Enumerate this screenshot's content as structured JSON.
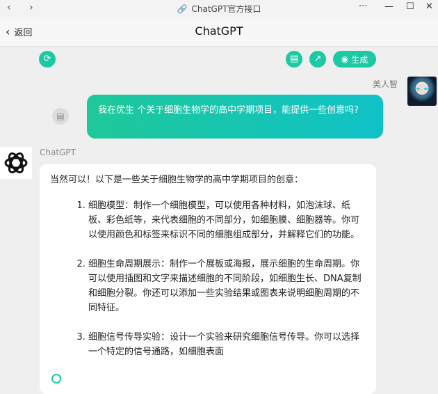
{
  "window": {
    "title": "ChatGPT官方接口",
    "nav_back": "‹",
    "nav_forward": "›",
    "link_icon": "link-icon",
    "menu": "···",
    "minimize": "—",
    "maximize": "☐",
    "close": "✕"
  },
  "header": {
    "back_label": "返回",
    "title": "ChatGPT"
  },
  "toolbar": {
    "generate_label": "生成"
  },
  "user_message": {
    "name": "美人智",
    "text": "我在优生 个关于细胞生物学的高中学期项目，能提供一些创意吗?"
  },
  "bot_message": {
    "name": "ChatGPT",
    "intro": "当然可以！以下是一些关于细胞生物学的高中学期项目的创意：",
    "items": [
      "细胞模型：制作一个细胞模型，可以使用各种材料，如泡沫球、纸板、彩色纸等，来代表细胞的不同部分，如细胞膜、细胞器等。你可以使用颜色和标签来标识不同的细胞组成部分，并解释它们的功能。",
      "细胞生命周期展示：制作一个展板或海报，展示细胞的生命周期。你可以使用插图和文字来描述细胞的不同阶段，如细胞生长、DNA复制和细胞分裂。你还可以添加一些实验结果或图表来说明细胞周期的不同特征。",
      "细胞信号传导实验：设计一个实验来研究细胞信号传导。你可以选择一个特定的信号通路，如细胞表面"
    ]
  },
  "colors": {
    "accent": "#1dc9a4",
    "bubble_gradient_start": "#1ec899",
    "bubble_gradient_end": "#10c2c8",
    "background": "#efefef"
  }
}
